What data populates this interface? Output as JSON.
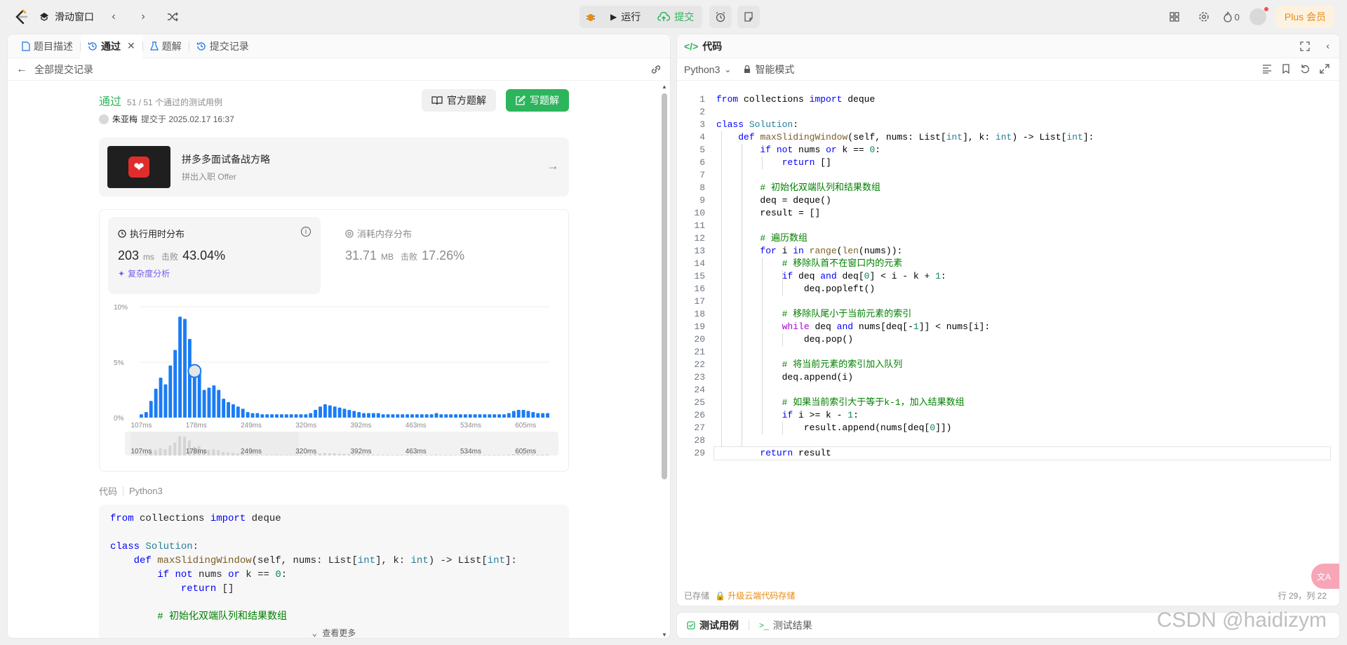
{
  "topbar": {
    "problem_set": "滑动窗口",
    "run_label": "运行",
    "submit_label": "提交",
    "plus_label": "Plus 会员",
    "streak_count": "0"
  },
  "left": {
    "tabs": [
      {
        "label": "题目描述"
      },
      {
        "label": "通过"
      },
      {
        "label": "题解"
      },
      {
        "label": "提交记录"
      }
    ],
    "back_label": "全部提交记录",
    "status": "通过",
    "cases": "51 / 51 个通过的测试用例",
    "submitter": "朱亚梅",
    "submitted_at": "提交于 2025.02.17 16:37",
    "official_btn": "官方题解",
    "write_btn": "写题解",
    "banner": {
      "title": "拼多多面试备战方略",
      "subtitle": "拼出入职 Offer"
    },
    "runtime": {
      "label": "执行用时分布",
      "value": "203",
      "unit": "ms",
      "beat_label": "击败",
      "beat_pct": "43.04%",
      "complexity": "复杂度分析"
    },
    "memory": {
      "label": "消耗内存分布",
      "value": "31.71",
      "unit": "MB",
      "beat_label": "击败",
      "beat_pct": "17.26%"
    },
    "code_label": "代码",
    "code_lang": "Python3",
    "view_more": "查看更多",
    "code_lines": [
      "from collections import deque",
      "",
      "class Solution:",
      "    def maxSlidingWindow(self, nums: List[int], k: int) -> List[int]:",
      "        if not nums or k == 0:",
      "            return []",
      "",
      "        # 初始化双端队列和结果数组"
    ]
  },
  "chart_data": {
    "type": "bar",
    "ylabel": "",
    "xlabel": "",
    "yticks": [
      "10%",
      "5%",
      "0%"
    ],
    "ylim": [
      0,
      10
    ],
    "xticks": [
      "107ms",
      "178ms",
      "249ms",
      "320ms",
      "392ms",
      "463ms",
      "534ms",
      "605ms"
    ],
    "highlight_index": 11,
    "values": [
      0.3,
      0.5,
      1.5,
      2.6,
      3.6,
      3.0,
      4.7,
      6.1,
      9.1,
      8.9,
      7.1,
      4.2,
      4.4,
      2.5,
      2.7,
      2.9,
      2.5,
      1.7,
      1.4,
      1.2,
      1.0,
      0.8,
      0.5,
      0.4,
      0.4,
      0.3,
      0.3,
      0.3,
      0.3,
      0.3,
      0.3,
      0.3,
      0.3,
      0.3,
      0.3,
      0.4,
      0.7,
      1.0,
      1.2,
      1.1,
      1.0,
      0.9,
      0.8,
      0.7,
      0.6,
      0.5,
      0.4,
      0.4,
      0.4,
      0.4,
      0.3,
      0.3,
      0.3,
      0.3,
      0.3,
      0.3,
      0.3,
      0.3,
      0.3,
      0.3,
      0.3,
      0.4,
      0.3,
      0.3,
      0.3,
      0.3,
      0.3,
      0.3,
      0.3,
      0.3,
      0.3,
      0.3,
      0.3,
      0.3,
      0.3,
      0.3,
      0.4,
      0.6,
      0.7,
      0.7,
      0.6,
      0.5,
      0.4,
      0.4,
      0.4
    ]
  },
  "right": {
    "title": "代码",
    "lang": "Python3",
    "mode": "智能模式",
    "saved": "已存储",
    "upgrade": "升级云端代码存储",
    "cursor": "行 29，列 22",
    "bottom_tabs": [
      {
        "label": "测试用例"
      },
      {
        "label": "测试结果"
      }
    ],
    "watermark": "CSDN @haidizym",
    "translate_icon": "文A",
    "lines": [
      "from collections import deque",
      "",
      "class Solution:",
      "    def maxSlidingWindow(self, nums: List[int], k: int) -> List[int]:",
      "        if not nums or k == 0:",
      "            return []",
      "",
      "        # 初始化双端队列和结果数组",
      "        deq = deque()",
      "        result = []",
      "",
      "        # 遍历数组",
      "        for i in range(len(nums)):",
      "            # 移除队首不在窗口内的元素",
      "            if deq and deq[0] < i - k + 1:",
      "                deq.popleft()",
      "",
      "            # 移除队尾小于当前元素的索引",
      "            while deq and nums[deq[-1]] < nums[i]:",
      "                deq.pop()",
      "",
      "            # 将当前元素的索引加入队列",
      "            deq.append(i)",
      "",
      "            # 如果当前索引大于等于k-1，加入结果数组",
      "            if i >= k - 1:",
      "                result.append(nums[deq[0]])",
      "",
      "        return result"
    ]
  }
}
